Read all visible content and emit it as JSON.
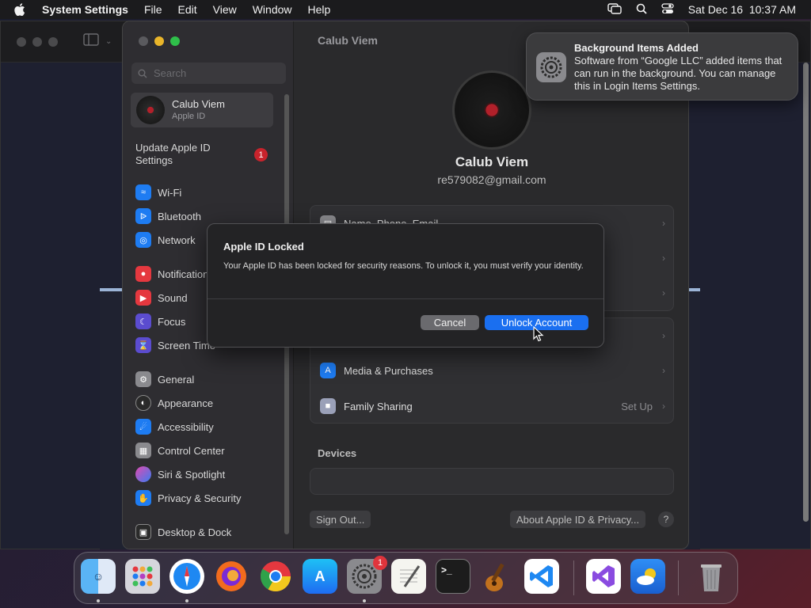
{
  "menubar": {
    "app_name": "System Settings",
    "menus": [
      "File",
      "Edit",
      "View",
      "Window",
      "Help"
    ],
    "datetime": "Sat Dec 16  10:37 AM"
  },
  "sidebar": {
    "search_placeholder": "Search",
    "account": {
      "name": "Calub Viem",
      "subtitle": "Apple ID"
    },
    "update": {
      "label": "Update Apple ID Settings",
      "badge": "1"
    },
    "items": [
      {
        "label": "Wi-Fi",
        "icon": "wifi-icon",
        "color": "#1e7cf2"
      },
      {
        "label": "Bluetooth",
        "icon": "bluetooth-icon",
        "color": "#1e7cf2"
      },
      {
        "label": "Network",
        "icon": "globe-icon",
        "color": "#1e7cf2"
      },
      {
        "label": "Notifications",
        "icon": "bell-icon",
        "color": "#e5383f"
      },
      {
        "label": "Sound",
        "icon": "speaker-icon",
        "color": "#e5383f"
      },
      {
        "label": "Focus",
        "icon": "moon-icon",
        "color": "#5b4ccf"
      },
      {
        "label": "Screen Time",
        "icon": "hourglass-icon",
        "color": "#5b4ccf"
      },
      {
        "label": "General",
        "icon": "gear-icon",
        "color": "#8a8a8e"
      },
      {
        "label": "Appearance",
        "icon": "appearance-icon",
        "color": "#2a2a2a"
      },
      {
        "label": "Accessibility",
        "icon": "accessibility-icon",
        "color": "#1e7cf2"
      },
      {
        "label": "Control Center",
        "icon": "control-center-icon",
        "color": "#8a8a8e"
      },
      {
        "label": "Siri & Spotlight",
        "icon": "siri-icon",
        "color": "#b33fc2"
      },
      {
        "label": "Privacy & Security",
        "icon": "hand-icon",
        "color": "#1e7cf2"
      },
      {
        "label": "Desktop & Dock",
        "icon": "dock-icon",
        "color": "#2a2a2a"
      }
    ]
  },
  "main": {
    "title": "Calub Viem",
    "name": "Calub Viem",
    "email": "re579082@gmail.com",
    "rows": [
      {
        "label": "Name, Phone, Email",
        "value": ""
      },
      {
        "label": "Media & Purchases",
        "value": ""
      },
      {
        "label": "Family Sharing",
        "value": "Set Up"
      }
    ],
    "devices_heading": "Devices",
    "sign_out": "Sign Out...",
    "about": "About Apple ID & Privacy...",
    "help": "?"
  },
  "dialog": {
    "title": "Apple ID Locked",
    "message": "Your Apple ID has been locked for security reasons. To unlock it, you must verify your identity.",
    "cancel": "Cancel",
    "confirm": "Unlock Account"
  },
  "notification": {
    "title": "Background Items Added",
    "body": "Software from “Google LLC” added items that can run in the background. You can manage this in Login Items Settings."
  },
  "dock": {
    "apps": [
      "Finder",
      "Launchpad",
      "Safari",
      "Firefox",
      "Chrome",
      "App Store",
      "System Settings",
      "TextEdit",
      "Terminal",
      "GarageBand",
      "Visual Studio Code",
      "Visual Studio",
      "Weather",
      "Trash"
    ],
    "settings_badge": "1"
  },
  "colors": {
    "accent": "#1a6ff0",
    "badge": "#c8232c"
  }
}
